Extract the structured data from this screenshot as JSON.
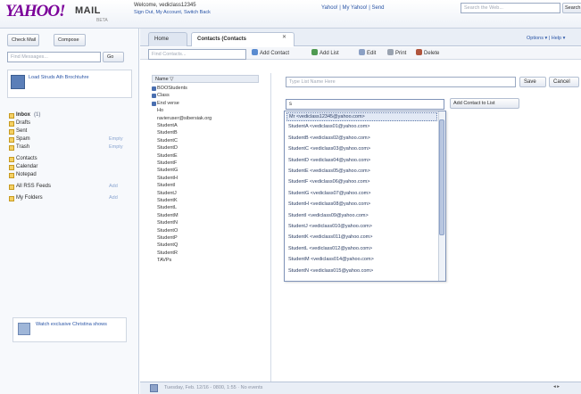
{
  "header": {
    "logo": "YAHOO!",
    "logo_mail": "MAIL",
    "logo_beta": "BETA",
    "welcome": "Welcome, vediclass12345",
    "welcome_sub": "Sign Out, My Account, Switch Back",
    "top_links": "Yahoo! | My Yahoo! | Send",
    "web_search_placeholder": "Search the Web...",
    "search_button": "Search"
  },
  "sidebar": {
    "check_mail": "Check Mail",
    "compose": "Compose",
    "find_placeholder": "Find Messages...",
    "go": "Go",
    "promo_top": "Load Struds Ath Brochtuhre",
    "folders": [
      {
        "label": "Inbox",
        "count": "(1)",
        "extra": "",
        "bold": true
      },
      {
        "label": "Drafts",
        "count": "",
        "extra": ""
      },
      {
        "label": "Sent",
        "count": "",
        "extra": ""
      },
      {
        "label": "Spam",
        "count": "",
        "extra": "Empty"
      },
      {
        "label": "Trash",
        "count": "",
        "extra": "Empty"
      },
      {
        "label": "Contacts",
        "count": "",
        "extra": ""
      },
      {
        "label": "Calendar",
        "count": "",
        "extra": ""
      },
      {
        "label": "Notepad",
        "count": "",
        "extra": ""
      },
      {
        "label": "All RSS Feeds",
        "count": "",
        "extra": "Add"
      },
      {
        "label": "My Folders",
        "count": "",
        "extra": "Add"
      }
    ],
    "promo_bottom": "Watch exclusive Christina shows"
  },
  "tabs": {
    "home": "Home",
    "contacts": "Contacts  (Contacts",
    "close": "✕",
    "options": "Options ▾ | Help ▾"
  },
  "toolbar": {
    "find_placeholder": "Find Contacts...",
    "add_contact": "Add Contact",
    "add_list": "Add List",
    "edit": "Edit",
    "print": "Print",
    "delete": "Delete"
  },
  "contacts": {
    "header": "Name ▽",
    "rows": [
      {
        "name": "BOOStudents",
        "icon": true
      },
      {
        "name": "Class",
        "icon": true
      },
      {
        "name": "End verse",
        "icon": true
      },
      {
        "name": "Ho",
        "icon": false
      },
      {
        "name": "ravieruser@sibersiak.org",
        "icon": false
      },
      {
        "name": "StudentA",
        "icon": false
      },
      {
        "name": "StudentB",
        "icon": false
      },
      {
        "name": "StudentC",
        "icon": false
      },
      {
        "name": "StudentD",
        "icon": false
      },
      {
        "name": "StudentE",
        "icon": false
      },
      {
        "name": "StudentF",
        "icon": false
      },
      {
        "name": "StudentG",
        "icon": false
      },
      {
        "name": "StudentH",
        "icon": false
      },
      {
        "name": "StudentI",
        "icon": false
      },
      {
        "name": "StudentJ",
        "icon": false
      },
      {
        "name": "StudentK",
        "icon": false
      },
      {
        "name": "StudentL",
        "icon": false
      },
      {
        "name": "StudentM",
        "icon": false
      },
      {
        "name": "StudentN",
        "icon": false
      },
      {
        "name": "StudentO",
        "icon": false
      },
      {
        "name": "StudentP",
        "icon": false
      },
      {
        "name": "StudentQ",
        "icon": false
      },
      {
        "name": "StudentR",
        "icon": false
      },
      {
        "name": "TAVPs",
        "icon": false
      }
    ]
  },
  "list_form": {
    "name_placeholder": "Type List Name Here",
    "save": "Save",
    "cancel": "Cancel",
    "add_value": "s",
    "add_button": "Add Contact to List"
  },
  "autocomplete": [
    "Mr <vediclass12345@yahoo.com>",
    "StudentA <vediclass01@yahoo.com>",
    "StudentB <vediclass02@yahoo.com>",
    "StudentC <vediclass03@yahoo.com>",
    "StudentD <vediclass04@yahoo.com>",
    "StudentE <vediclass05@yahoo.com>",
    "StudentF <vediclass06@yahoo.com>",
    "StudentG <vediclass07@yahoo.com>",
    "StudentH <vediclass08@yahoo.com>",
    "StudentI <vediclass09@yahoo.com>",
    "StudentJ <vediclass010@yahoo.com>",
    "StudentK <vediclass011@yahoo.com>",
    "StudentL <vediclass012@yahoo.com>",
    "StudentM <vediclass014@yahoo.com>",
    "StudentN <vediclass015@yahoo.com>"
  ],
  "statusbar": {
    "text": "Tuesday, Feb. 12/16 - 0800, 1:55 · No events",
    "pager": "◂  ▸"
  }
}
